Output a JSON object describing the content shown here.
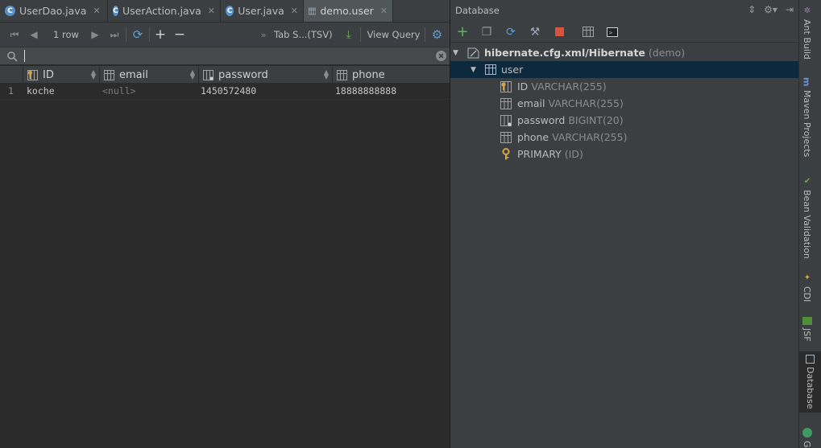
{
  "editor_tabs": [
    {
      "label": "UserDao.java",
      "icon": "java-class-icon"
    },
    {
      "label": "UserAction.java",
      "icon": "java-class-icon"
    },
    {
      "label": "User.java",
      "icon": "java-class-icon"
    },
    {
      "label": "demo.user",
      "icon": "table-icon",
      "active": true
    }
  ],
  "toolbar": {
    "row_count": "1 row",
    "format": "Tab S...(TSV)",
    "view_query": "View Query"
  },
  "filter": {
    "value": ""
  },
  "grid": {
    "columns": [
      {
        "name": "ID",
        "icon": "primary-key-column-icon"
      },
      {
        "name": "email",
        "icon": "column-icon"
      },
      {
        "name": "password",
        "icon": "column-icon"
      },
      {
        "name": "phone",
        "icon": "column-icon"
      }
    ],
    "rows": [
      {
        "num": "1",
        "ID": "koche",
        "email": "<null>",
        "password": "1450572480",
        "phone": "18888888888"
      }
    ]
  },
  "database_panel": {
    "title": "Database",
    "datasource": {
      "name": "hibernate.cfg.xml/Hibernate",
      "suffix": "(demo)"
    },
    "table": {
      "name": "user"
    },
    "columns": [
      {
        "name": "ID",
        "type": "VARCHAR(255)",
        "icon": "primary-key-column-icon"
      },
      {
        "name": "email",
        "type": "VARCHAR(255)",
        "icon": "column-icon"
      },
      {
        "name": "password",
        "type": "BIGINT(20)",
        "icon": "column-icon"
      },
      {
        "name": "phone",
        "type": "VARCHAR(255)",
        "icon": "column-icon"
      }
    ],
    "key": {
      "name": "PRIMARY",
      "detail": "(ID)",
      "icon": "key-icon"
    }
  },
  "tool_windows": [
    {
      "label": "Ant Build",
      "icon": "ant-icon"
    },
    {
      "label": "Maven Projects",
      "icon": "maven-icon"
    },
    {
      "label": "Bean Validation",
      "icon": "bean-validation-icon"
    },
    {
      "label": "CDI",
      "icon": "cdi-icon"
    },
    {
      "label": "JSF",
      "icon": "jsf-icon"
    },
    {
      "label": "Database",
      "icon": "database-icon",
      "active": true
    },
    {
      "label": "G",
      "icon": "gradle-icon"
    }
  ]
}
